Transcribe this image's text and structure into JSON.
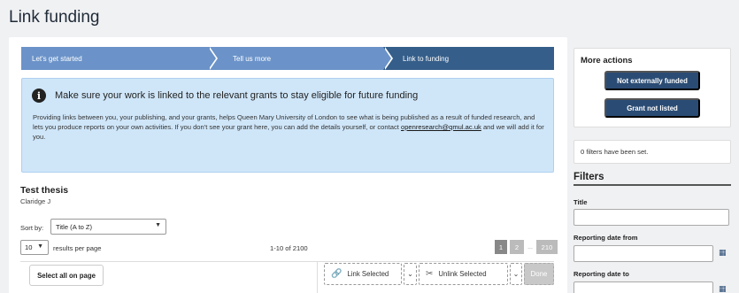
{
  "page": {
    "title": "Link funding"
  },
  "stepper": {
    "steps": [
      "Let's get started",
      "Tell us more",
      "Link to funding"
    ],
    "active_index": 2
  },
  "alert": {
    "title": "Make sure your work is linked to the relevant grants to stay eligible for future funding",
    "body_part1": "Providing links between you, your publishing, and your grants, helps Queen Mary University of London to see what is being published as a result of funded research, and lets you produce reports on your own activities.  If you don't see your grant here, you can add the details yourself, or contact ",
    "email": "openresearch@qmul.ac.uk",
    "body_part2": " and we will add it for you."
  },
  "record": {
    "title": "Test thesis",
    "author": "Claridge J"
  },
  "sort": {
    "label": "Sort by:",
    "value": "Title (A to Z)"
  },
  "paging": {
    "per_page": "10",
    "per_page_label": "results per page",
    "range": "1-10 of 2100",
    "pages": [
      "1",
      "2",
      "...",
      "210"
    ],
    "current": "1"
  },
  "toolbar": {
    "select_all": "Select all on page",
    "link_selected": "Link Selected",
    "unlink_selected": "Unlink Selected",
    "done": "Done"
  },
  "side": {
    "more_actions_title": "More actions",
    "not_externally_funded": "Not externally funded",
    "grant_not_listed": "Grant not listed",
    "filter_status": "0 filters have been set.",
    "filters_heading": "Filters",
    "field_title": "Title",
    "field_reporting_from": "Reporting date from",
    "field_reporting_to": "Reporting date to"
  },
  "colors": {
    "step_inactive": "#6b93c9",
    "step_active": "#355e8a",
    "alert_bg": "#cfe6f9",
    "primary_button": "#2a4c74"
  }
}
